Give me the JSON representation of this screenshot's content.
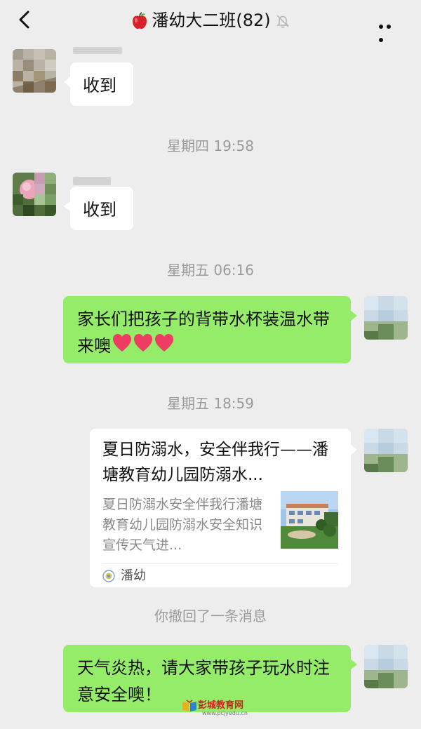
{
  "header": {
    "title": "潘幼大二班(82)",
    "back_icon": "chevron-left-icon",
    "apple_icon": "red-apple-icon",
    "mute_icon": "bell-muted-icon",
    "more_icon": "more-dots-icon"
  },
  "messages": [
    {
      "text": "收到"
    },
    {
      "text": "收到"
    },
    {
      "text": "家长们把孩子的背带水杯装温水带来噢"
    },
    {
      "text": "天气炎热，请大家带孩子玩水时注意安全噢！"
    }
  ],
  "times": [
    "星期四 19:58",
    "星期五 06:16",
    "星期五 18:59"
  ],
  "card": {
    "title": "夏日防溺水，安全伴我行——潘塘教育幼儿园防溺水...",
    "description": "夏日防溺水安全伴我行潘塘教育幼儿园防溺水安全知识宣传天气进...",
    "source": "潘幼"
  },
  "system_notice": "你撤回了一条消息",
  "watermark": {
    "main": "彭城教育网",
    "sub": "www.pcjyedu.cn"
  },
  "colors": {
    "background": "#ededed",
    "sent_bubble": "#95ec69",
    "received_bubble": "#ffffff"
  }
}
